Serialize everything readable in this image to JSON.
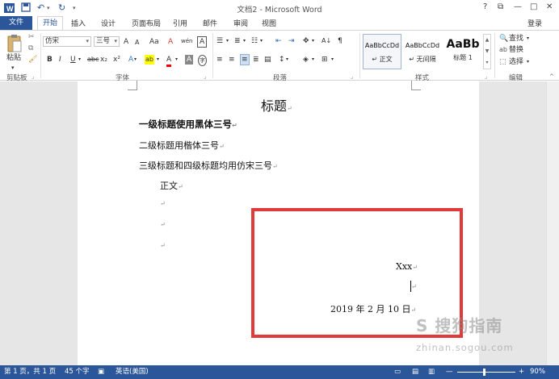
{
  "title": "文档2 - Microsoft Word",
  "window_controls": {
    "help": "?",
    "restore": "⧉",
    "minimize": "—",
    "maximize": "□",
    "close": "✕"
  },
  "tabs": {
    "file": "文件",
    "home": "开始",
    "insert": "插入",
    "design": "设计",
    "layout": "页面布局",
    "references": "引用",
    "mailings": "邮件",
    "review": "审阅",
    "view": "视图"
  },
  "login": "登录",
  "ribbon": {
    "clipboard": {
      "paste": "粘贴",
      "label": "剪贴板"
    },
    "font": {
      "label": "字体",
      "font_name": "仿宋",
      "font_size": "三号",
      "grow": "A",
      "shrink": "A",
      "case": "Aa",
      "clear": "A",
      "phonetic": "wén",
      "border": "A",
      "bold": "B",
      "italic": "I",
      "underline": "U",
      "strike": "abc",
      "subscript": "x₂",
      "superscript": "x²",
      "effects": "A",
      "highlight": "ab",
      "color": "A",
      "shading": "A",
      "enclose": "字"
    },
    "paragraph": {
      "label": "段落"
    },
    "styles": {
      "label": "样式",
      "items": [
        {
          "preview": "AaBbCcDd",
          "name": "↵ 正文"
        },
        {
          "preview": "AaBbCcDd",
          "name": "↵ 无间隔"
        },
        {
          "preview": "AaBb",
          "name": "标题 1"
        }
      ]
    },
    "editing": {
      "label": "编辑",
      "find": "查找",
      "replace": "替换",
      "select": "选择"
    }
  },
  "document": {
    "title": "标题",
    "lines": [
      "一级标题使用黑体三号",
      "二级标题用楷体三号",
      "三级标题和四级标题均用仿宋三号",
      "正文"
    ],
    "signature": "Xxx",
    "date": "2019 年 2 月 10 日",
    "para_mark": "↵"
  },
  "watermark": {
    "brand": "S 搜狗指南",
    "url": "zhinan.sogou.com"
  },
  "status": {
    "page": "第 1 页，共 1 页",
    "words": "45 个字",
    "language": "英语(美国)",
    "zoom": "90%"
  },
  "colors": {
    "accent": "#2b579a",
    "highlight_red": "#e03a3a"
  }
}
